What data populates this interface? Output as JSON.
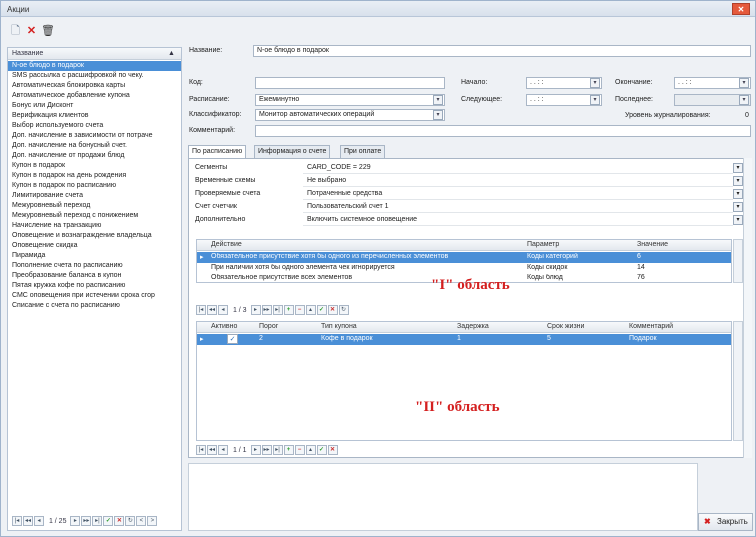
{
  "window": {
    "title": "Акции"
  },
  "toolbar": {
    "new_icon": "new-document-icon",
    "delete_icon": "delete-x-icon",
    "trash_icon": "trash-icon"
  },
  "left_list": {
    "header": "Название",
    "items": [
      "N-ое блюдо в подарок",
      "SMS рассылка с расшифровкой по чеку.",
      "Автоматическая блокировка карты",
      "Автоматическое добавление купона",
      "Бонус или Дисконт",
      "Верификация клиентов",
      "Выбор используемого счета",
      "Доп. начисление в зависимости от потраче",
      "Доп. начисление на бонусный счет.",
      "Доп. начисление от продажи блюд",
      "Купон в подарок",
      "Купон в подарок на день рождения",
      "Купон в подарок по расписанию",
      "Лимитирование счета",
      "Межуровневый переход",
      "Межуровневый переход с понижением",
      "Начисление на транзакцию",
      "Оповещение и вознаграждение владельца",
      "Оповещение скидка",
      "Пирамида",
      "Пополнение счета по расписанию",
      "Преобразование баланса в купон",
      "Пятая кружка кофе по расписанию",
      "СМС оповещения при истечении срока сгор",
      "Списание с счета по расписанию"
    ],
    "selected_index": 0,
    "nav_page": "1 / 25"
  },
  "form": {
    "name_label": "Название:",
    "name_value": "N-ое блюдо в подарок",
    "code_label": "Код:",
    "code_value": "",
    "schedule_label": "Расписание:",
    "schedule_value": "Ежеминутно",
    "classifier_label": "Классификатор:",
    "classifier_value": "Монитор автоматических операций",
    "comment_label": "Комментарий:",
    "comment_value": "",
    "start_label": "Начало:",
    "start_value": ". .   : :",
    "end_label": "Окончание:",
    "end_value": ". .   : :",
    "next_label": "Следующее:",
    "next_value": ". .   : :",
    "last_label": "Последнее:",
    "last_value": "",
    "log_level_label": "Уровень журналирования:",
    "log_level_value": "0"
  },
  "tabs": [
    "По расписанию",
    "Информация о счете",
    "При оплате"
  ],
  "active_tab": 0,
  "props": [
    {
      "label": "Сегменты",
      "value": "CARD_CODE = 229"
    },
    {
      "label": "Временные схемы",
      "value": "Не выбрано"
    },
    {
      "label": "Проверяемые счета",
      "value": "Потраченные средства"
    },
    {
      "label": "Счет счетчик",
      "value": "Пользовательский счет 1"
    },
    {
      "label": "Дополнительно",
      "value": "Включить системное оповещение"
    }
  ],
  "grid1": {
    "headers": [
      "Действие",
      "Параметр",
      "Значение"
    ],
    "rows": [
      [
        "Обязательное присутствие хотя бы одного из перечисленных элементов",
        "Коды категорий",
        "6"
      ],
      [
        "При наличии хотя бы одного элемента чек игнорируется",
        "Коды скидок",
        "14"
      ],
      [
        "Обязательное присутствие всех элементов",
        "Коды блюд",
        "76"
      ]
    ],
    "nav_page": "1 / 3"
  },
  "grid2": {
    "headers": [
      "Активно",
      "Порог",
      "Тип купона",
      "Задержка",
      "Срок жизни",
      "Комментарий"
    ],
    "rows": [
      [
        "✓",
        "2",
        "Кофе в подарок",
        "1",
        "5",
        "Подарок"
      ]
    ],
    "nav_page": "1 / 1"
  },
  "annotations": {
    "area1": "\"I\" область",
    "area2": "\"II\" область"
  },
  "close_button": "Закрыть",
  "colors": {
    "selection": "#4a8fd7",
    "annotation": "#d42020"
  }
}
